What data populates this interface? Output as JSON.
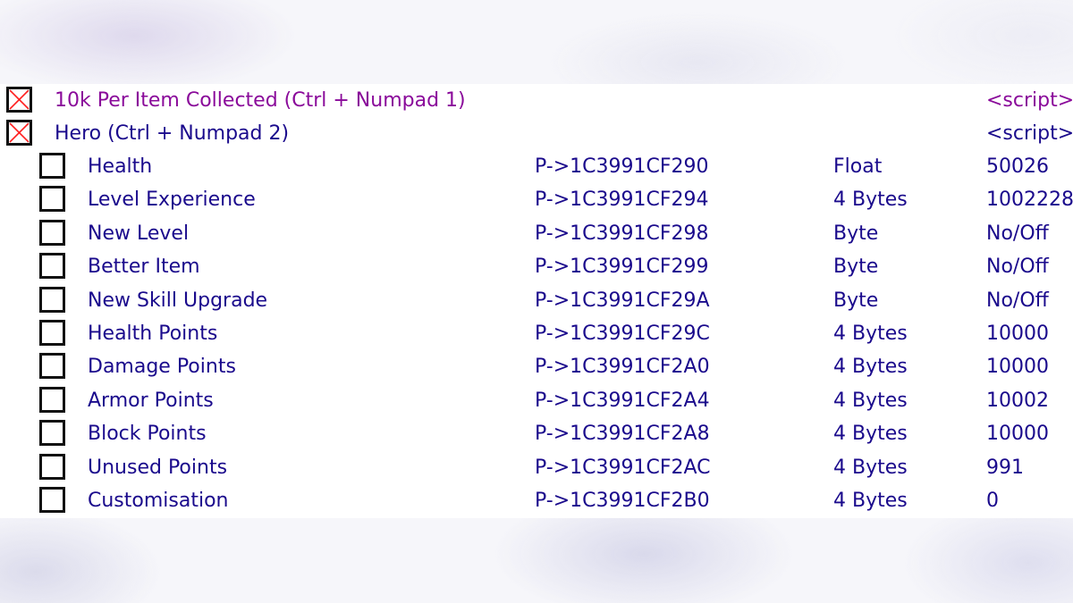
{
  "cheat_table": {
    "scripts": [
      {
        "description": "10k Per Item Collected (Ctrl + Numpad 1)",
        "value": "<script>",
        "active_marker": "red-x",
        "color": "#8a0a9a"
      },
      {
        "description": "Hero (Ctrl + Numpad 2)",
        "value": "<script>",
        "active_marker": "red-x",
        "color": "#1a0a8c"
      }
    ],
    "entries": [
      {
        "description": "Health",
        "address": "P->1C3991CF290",
        "type": "Float",
        "value": "50026",
        "checked": false
      },
      {
        "description": "Level Experience",
        "address": "P->1C3991CF294",
        "type": "4 Bytes",
        "value": "1002228",
        "checked": false
      },
      {
        "description": "New Level",
        "address": "P->1C3991CF298",
        "type": "Byte",
        "value": "No/Off",
        "checked": false
      },
      {
        "description": "Better Item",
        "address": "P->1C3991CF299",
        "type": "Byte",
        "value": "No/Off",
        "checked": false
      },
      {
        "description": "New Skill Upgrade",
        "address": "P->1C3991CF29A",
        "type": "Byte",
        "value": "No/Off",
        "checked": false
      },
      {
        "description": "Health Points",
        "address": "P->1C3991CF29C",
        "type": "4 Bytes",
        "value": "10000",
        "checked": false
      },
      {
        "description": "Damage Points",
        "address": "P->1C3991CF2A0",
        "type": "4 Bytes",
        "value": "10000",
        "checked": false
      },
      {
        "description": "Armor Points",
        "address": "P->1C3991CF2A4",
        "type": "4 Bytes",
        "value": "10002",
        "checked": false
      },
      {
        "description": "Block Points",
        "address": "P->1C3991CF2A8",
        "type": "4 Bytes",
        "value": "10000",
        "checked": false
      },
      {
        "description": "Unused Points",
        "address": "P->1C3991CF2AC",
        "type": "4 Bytes",
        "value": "991",
        "checked": false
      },
      {
        "description": "Customisation",
        "address": "P->1C3991CF2B0",
        "type": "4 Bytes",
        "value": "0",
        "checked": false
      }
    ],
    "colors": {
      "entry_text": "#1a0a8c",
      "script_text": "#8a0a9a",
      "x_mark": "#ff2020"
    }
  }
}
